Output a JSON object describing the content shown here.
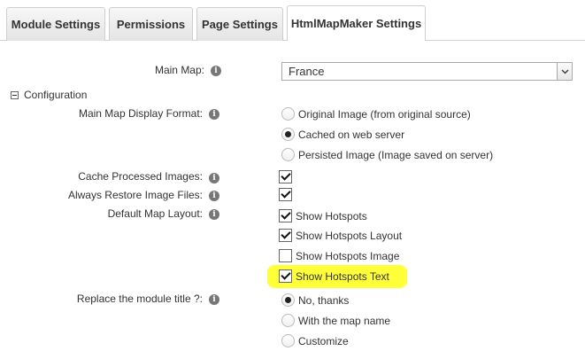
{
  "tabs": [
    {
      "label": "Module Settings"
    },
    {
      "label": "Permissions"
    },
    {
      "label": "Page Settings"
    },
    {
      "label": "HtmlMapMaker Settings"
    }
  ],
  "main_map": {
    "label": "Main Map:",
    "value": "France"
  },
  "configuration": {
    "title": "Configuration"
  },
  "display_format": {
    "label": "Main Map Display Format:",
    "options": [
      "Original Image (from original source)",
      "Cached on web server",
      "Persisted Image (Image saved on server)"
    ],
    "selected": "Cached on web server"
  },
  "cache_processed": {
    "label": "Cache Processed Images:",
    "checked": true
  },
  "always_restore": {
    "label": "Always Restore Image Files:",
    "checked": true
  },
  "default_layout": {
    "label": "Default Map Layout:",
    "options": [
      {
        "label": "Show Hotspots",
        "checked": true
      },
      {
        "label": "Show Hotspots Layout",
        "checked": true
      },
      {
        "label": "Show Hotspots Image",
        "checked": false
      },
      {
        "label": "Show Hotspots Text",
        "checked": true
      }
    ]
  },
  "replace_title": {
    "label": "Replace the module title ?:",
    "options": [
      "No, thanks",
      "With the map name",
      "Customize"
    ],
    "selected": "No, thanks"
  },
  "colors": {
    "highlight": "#ffff3a"
  }
}
